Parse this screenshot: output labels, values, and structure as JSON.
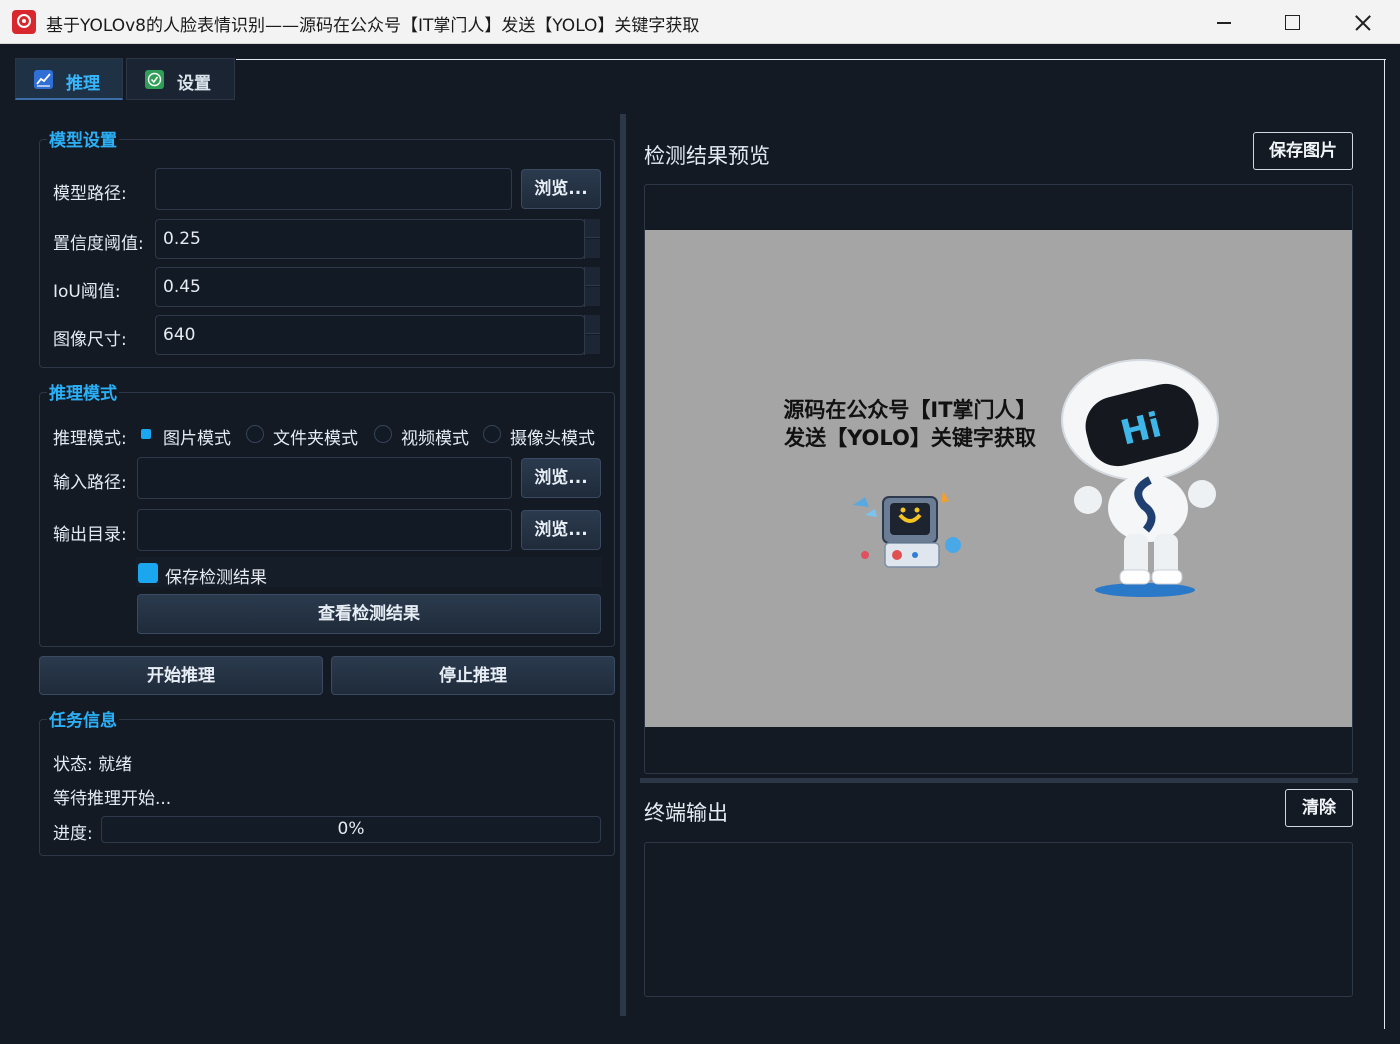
{
  "window": {
    "title": "基于YOLOv8的人脸表情识别——源码在公众号【IT掌门人】发送【YOLO】关键字获取"
  },
  "tabs": [
    {
      "label": "推理",
      "icon": "chart-icon",
      "active": true
    },
    {
      "label": "设置",
      "icon": "check-badge-icon",
      "active": false
    }
  ],
  "model_settings": {
    "title": "模型设置",
    "model_path_label": "模型路径:",
    "model_path_value": "",
    "browse_label": "浏览...",
    "confidence_label": "置信度阈值:",
    "confidence_value": "0.25",
    "iou_label": "IoU阈值:",
    "iou_value": "0.45",
    "imgsz_label": "图像尺寸:",
    "imgsz_value": "640"
  },
  "inference_mode": {
    "title": "推理模式",
    "mode_label": "推理模式:",
    "options": [
      "图片模式",
      "文件夹模式",
      "视频模式",
      "摄像头模式"
    ],
    "selected": "图片模式",
    "input_label": "输入路径:",
    "input_value": "",
    "output_label": "输出目录:",
    "output_value": "",
    "browse_label": "浏览...",
    "save_results_label": "保存检测结果",
    "save_results_checked": true,
    "view_results_label": "查看检测结果"
  },
  "actions": {
    "start_label": "开始推理",
    "stop_label": "停止推理"
  },
  "task_info": {
    "title": "任务信息",
    "status": "状态: 就绪",
    "message": "等待推理开始...",
    "progress_label": "进度:",
    "progress_text": "0%",
    "progress_value": 0
  },
  "preview": {
    "title": "检测结果预览",
    "save_label": "保存图片",
    "promo_line1": "源码在公众号【IT掌门人】",
    "promo_line2": "发送【YOLO】关键字获取",
    "robot_text": "Hi"
  },
  "terminal": {
    "title": "终端输出",
    "clear_label": "清除",
    "content": ""
  },
  "colors": {
    "accent": "#2bb0f7",
    "background": "#131a24",
    "preview_bg": "#a5a5a5"
  }
}
